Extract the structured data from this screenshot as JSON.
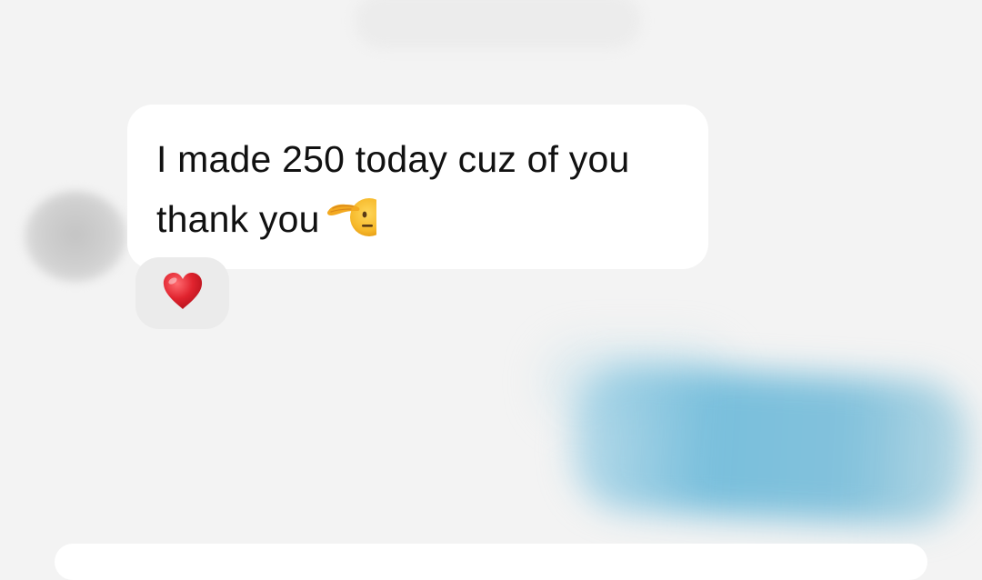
{
  "chat": {
    "message": {
      "text": "I made 250 today cuz of you\nthank you",
      "emoji": "saluting-face-emoji"
    },
    "reaction": {
      "emoji": "red-heart-emoji"
    }
  },
  "colors": {
    "background": "#f3f3f3",
    "incoming_bubble": "#ffffff",
    "reaction_pill": "#ebebeb",
    "outgoing_blurred": "#79bfdc",
    "heart": "#e0232e"
  }
}
